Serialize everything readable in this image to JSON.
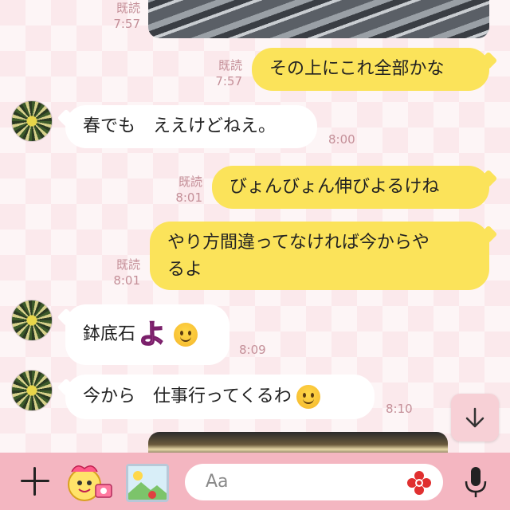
{
  "messages": [
    {
      "id": "m0",
      "side": "out",
      "type": "photo",
      "read": "既読",
      "time": "7:57"
    },
    {
      "id": "m1",
      "side": "out",
      "text": "その上にこれ全部かな",
      "read": "既読",
      "time": "7:57"
    },
    {
      "id": "m2",
      "side": "in",
      "text": "春でも　ええけどねえ。",
      "time": "8:00"
    },
    {
      "id": "m3",
      "side": "out",
      "text": "びょんびょん伸びよるけね",
      "read": "既読",
      "time": "8:01"
    },
    {
      "id": "m4",
      "side": "out",
      "line1": "やり方間違ってなければ今からや",
      "line2": "るよ",
      "read": "既読",
      "time": "8:01"
    },
    {
      "id": "m5",
      "side": "in",
      "text": "鉢底石",
      "sticker": "よ",
      "emoji": "smiling-face-icon",
      "time": "8:09"
    },
    {
      "id": "m6",
      "side": "in",
      "text": "今から　仕事行ってくるわ",
      "emoji": "smiling-face-icon",
      "time": "8:10"
    },
    {
      "id": "m7",
      "side": "out",
      "type": "photo"
    }
  ],
  "composer": {
    "placeholder": "Aa"
  },
  "colors": {
    "outgoing_bubble": "#fbe35a",
    "incoming_bubble": "#ffffff",
    "toolbar": "#f4b6c1",
    "background": "#fbe9ec",
    "meta_text": "#c48f98"
  },
  "icons": {
    "plus": "plus-icon",
    "sticker": "sticker-icon",
    "photo": "photo-icon",
    "emoji": "emoji-icon",
    "mic": "microphone-icon",
    "scroll_down": "arrow-down-icon"
  }
}
